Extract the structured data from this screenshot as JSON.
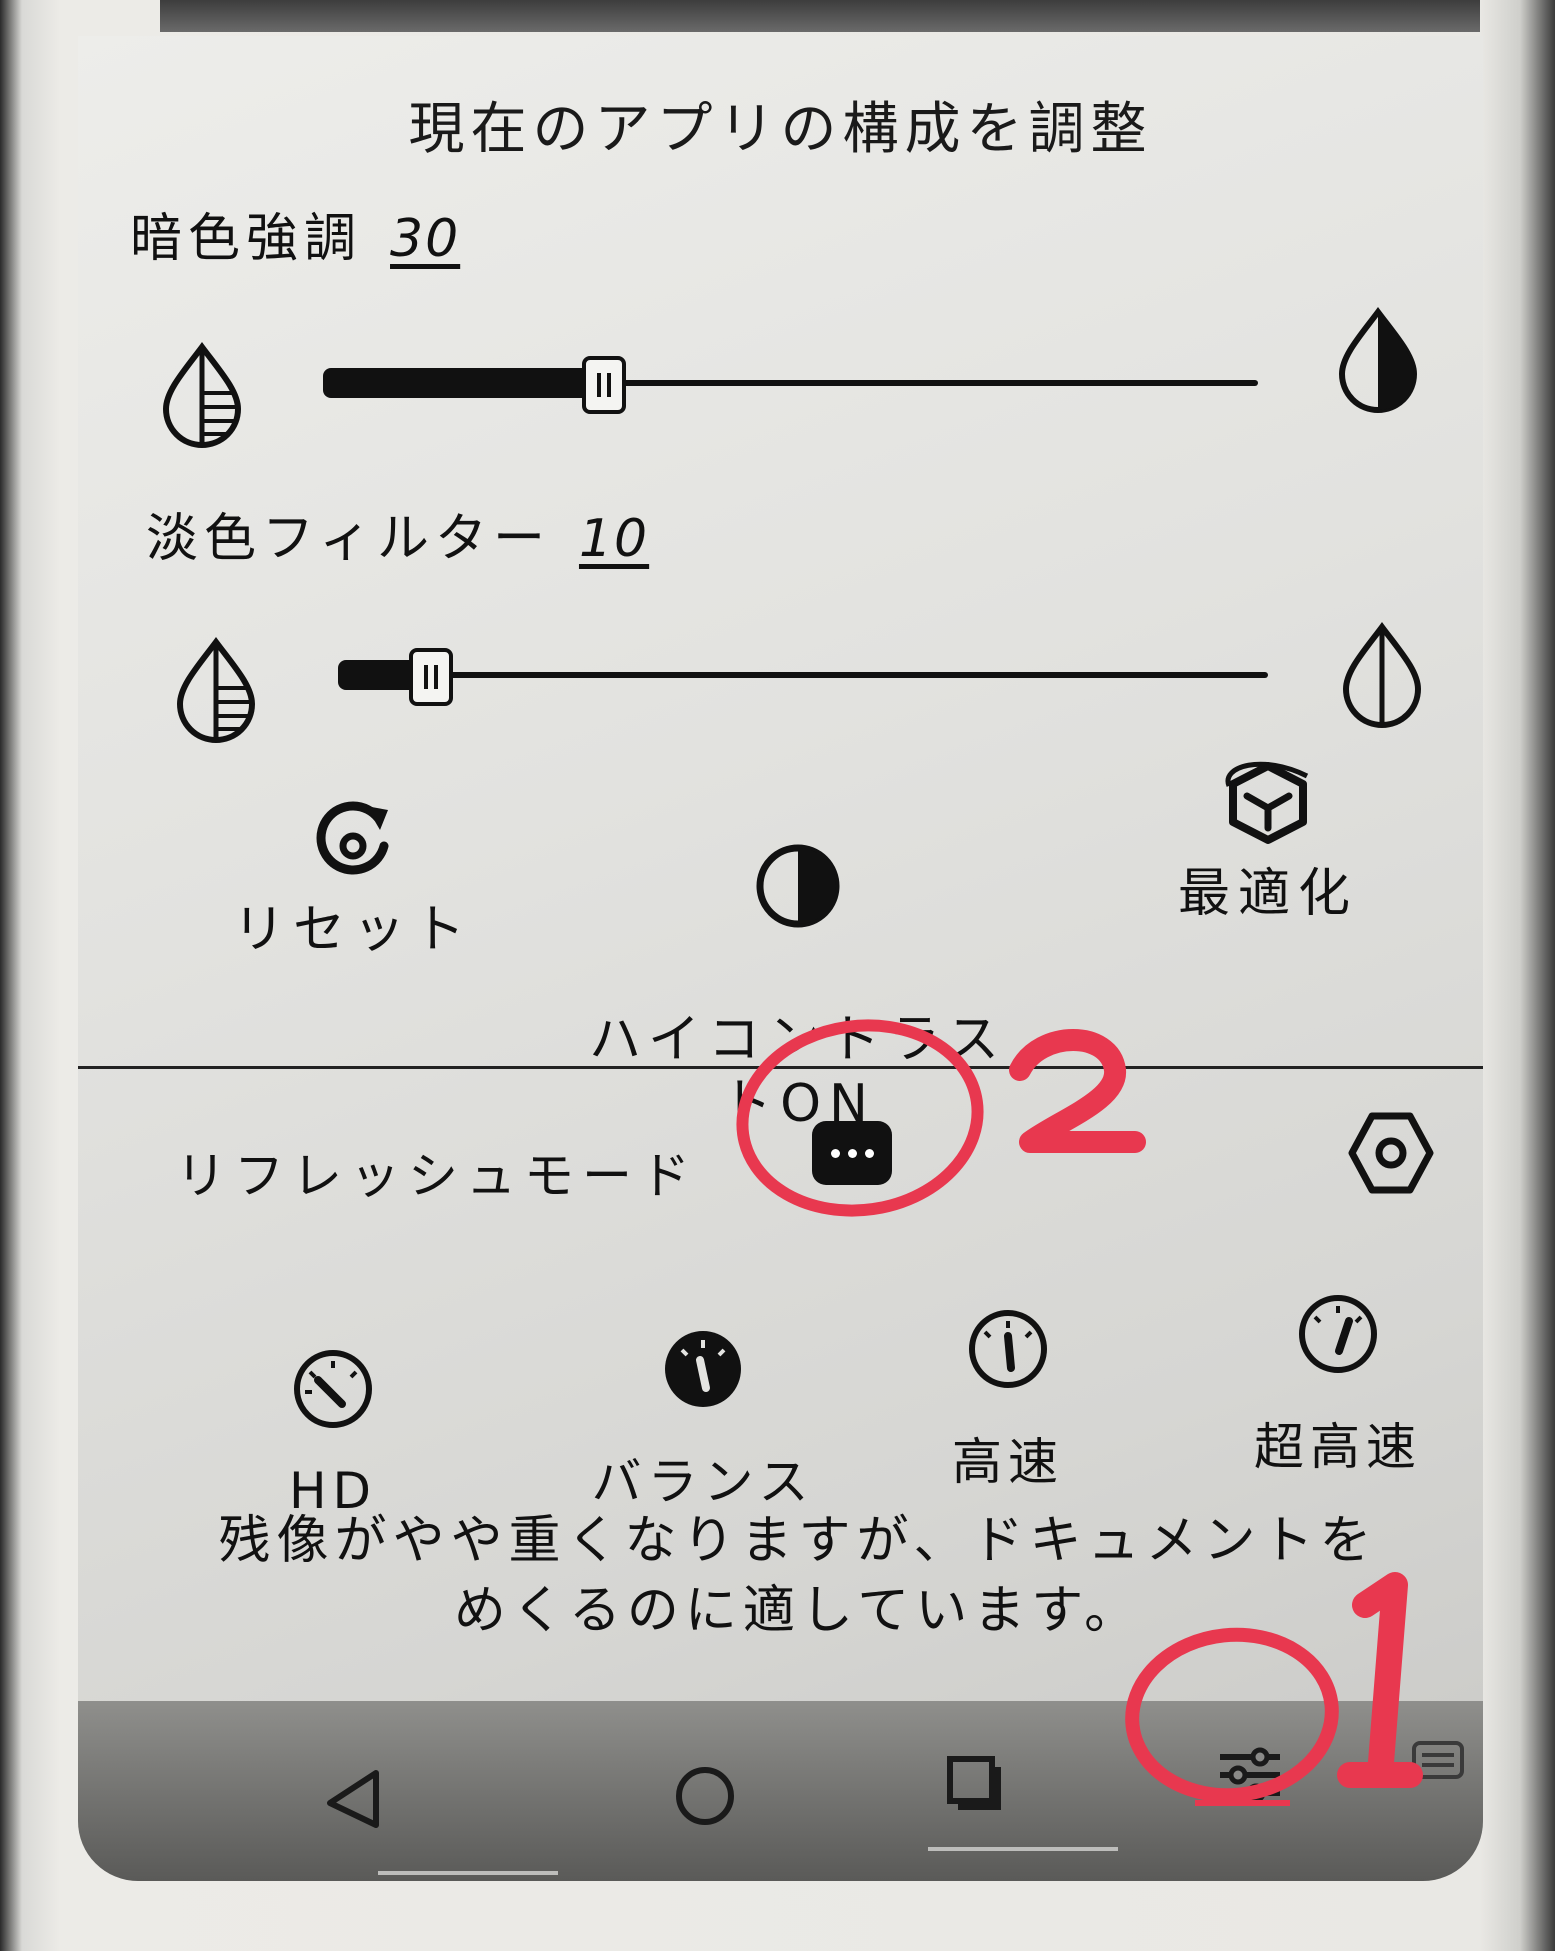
{
  "panel": {
    "title": "現在のアプリの構成を調整"
  },
  "dark_enhance": {
    "label": "暗色強調",
    "value": "30",
    "level_percent": 30
  },
  "light_filter": {
    "label": "淡色フィルター",
    "value": "10",
    "level_percent": 10
  },
  "actions": {
    "reset": "リセット",
    "high_contrast": "ハイコントラス\nトON",
    "optimize": "最適化"
  },
  "refresh": {
    "label": "リフレッシュモード",
    "modes": [
      "HD",
      "バランス",
      "高速",
      "超高速"
    ],
    "selected": "バランス",
    "description": "残像がやや重くなりますが、ドキュメントを\nめくるのに適しています。"
  },
  "annotations": {
    "one": "1",
    "two": "2",
    "color": "#e8384f"
  },
  "colors": {
    "ink": "#111111",
    "screen": "#e4e4e1"
  }
}
